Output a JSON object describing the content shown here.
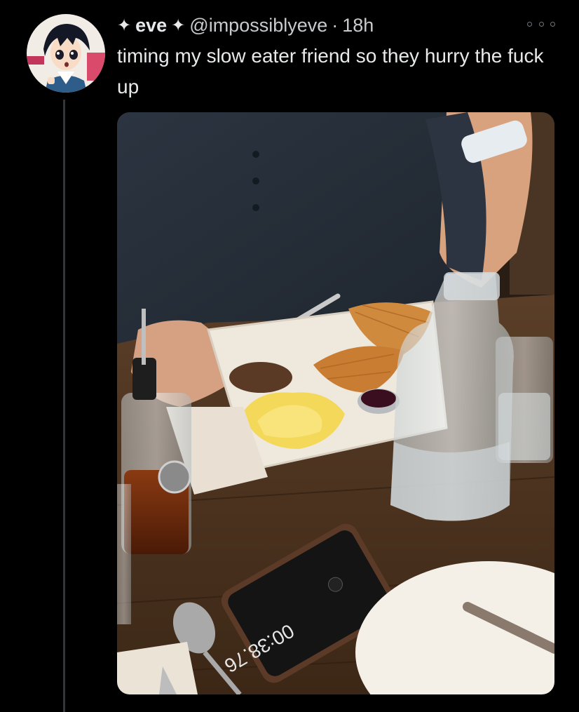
{
  "tweet": {
    "display_name": "eve",
    "name_decoration_icon": "four-point-star",
    "handle": "@impossiblyeve",
    "separator": "·",
    "time": "18h",
    "more_icon": "more-dots-icon",
    "text": "timing my slow eater friend so they hurry the fuck up"
  },
  "media": {
    "phone_screen_text": "00:38.76"
  },
  "colors": {
    "background": "#000000",
    "text_primary": "#e7e9ea",
    "text_secondary": "#c8cbcd",
    "thread_line": "#333639"
  }
}
